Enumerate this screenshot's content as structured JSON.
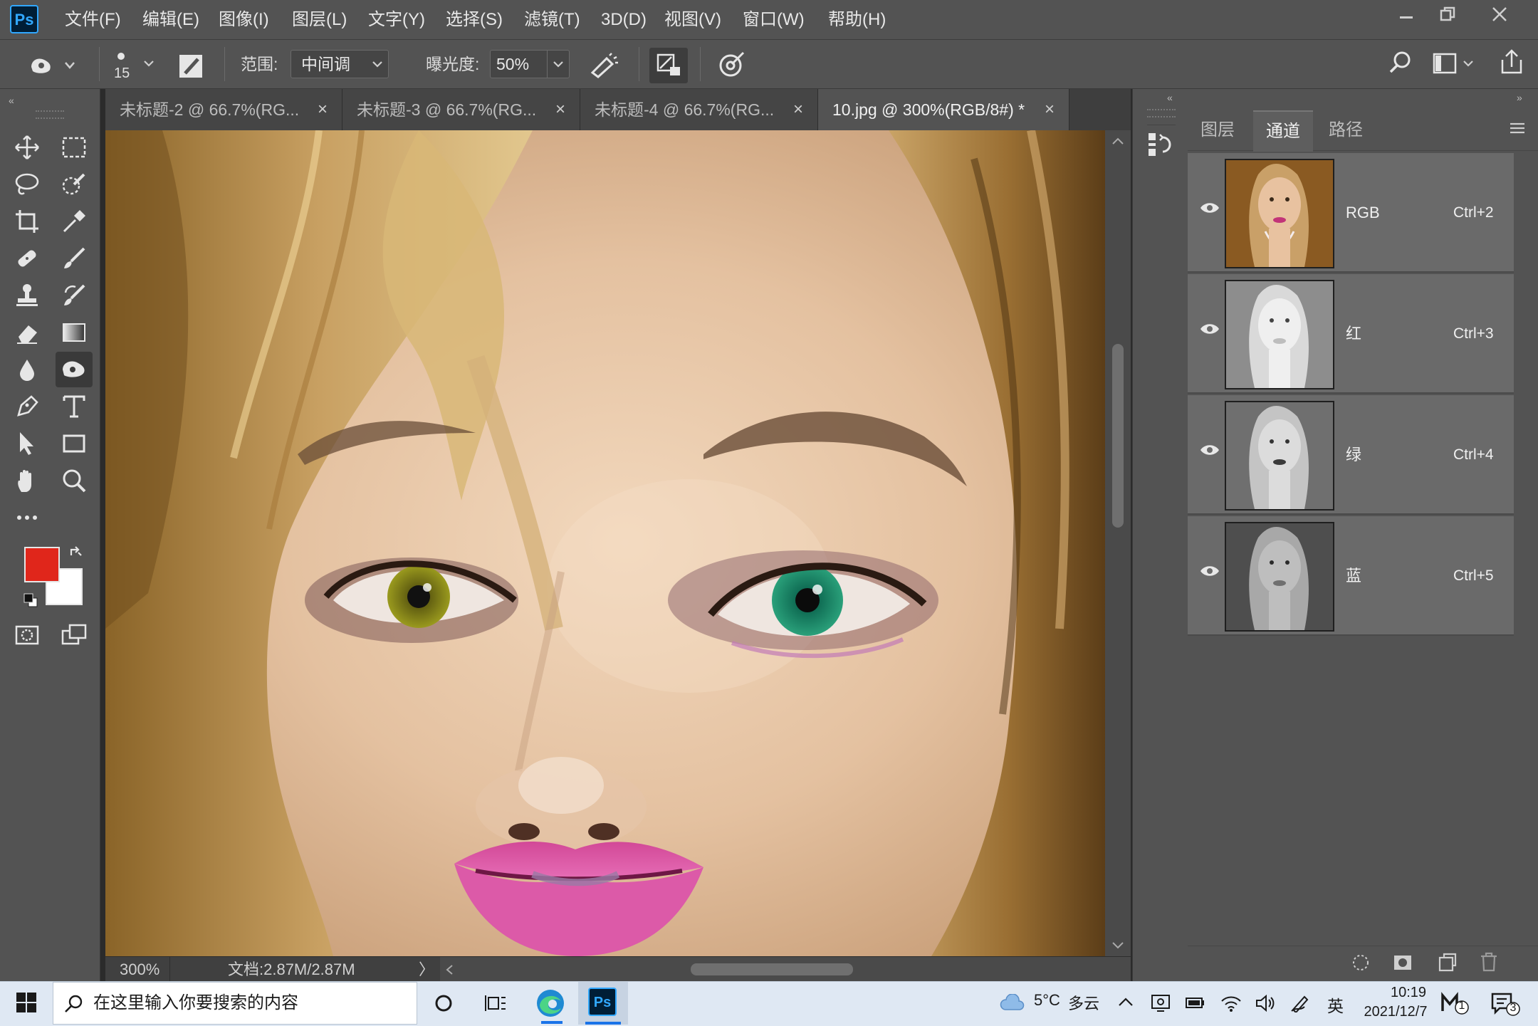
{
  "app": {
    "logo": "Ps"
  },
  "menu": [
    "文件(F)",
    "编辑(E)",
    "图像(I)",
    "图层(L)",
    "文字(Y)",
    "选择(S)",
    "滤镜(T)",
    "3D(D)",
    "视图(V)",
    "窗口(W)",
    "帮助(H)"
  ],
  "options": {
    "brush_size": "15",
    "range_label": "范围:",
    "range_value": "中间调",
    "exposure_label": "曝光度:",
    "exposure_value": "50%"
  },
  "tabs": [
    {
      "label": "未标题-2 @ 66.7%(RG...",
      "active": false
    },
    {
      "label": "未标题-3 @ 66.7%(RG...",
      "active": false
    },
    {
      "label": "未标题-4 @ 66.7%(RG...",
      "active": false
    },
    {
      "label": "10.jpg @ 300%(RGB/8#) *",
      "active": true
    }
  ],
  "tab_close_glyph": "×",
  "status": {
    "zoom": "300%",
    "doc_info": "文档:2.87M/2.87M",
    "more": "〉"
  },
  "colors": {
    "foreground": "#e0261b",
    "background": "#ffffff",
    "accent": "#31a8ff"
  },
  "panel": {
    "tabs": [
      "图层",
      "通道",
      "路径"
    ],
    "active_tab": "通道",
    "channels": [
      {
        "name": "RGB",
        "shortcut": "Ctrl+2",
        "kind": "color"
      },
      {
        "name": "红",
        "shortcut": "Ctrl+3",
        "kind": "gray-light"
      },
      {
        "name": "绿",
        "shortcut": "Ctrl+4",
        "kind": "gray-mid"
      },
      {
        "name": "蓝",
        "shortcut": "Ctrl+5",
        "kind": "gray-dark"
      }
    ]
  },
  "taskbar": {
    "search_placeholder": "在这里输入你要搜索的内容",
    "weather_temp": "5°C",
    "weather_desc": "多云",
    "ime": "英",
    "time": "10:19",
    "date": "2021/12/7",
    "notification_count": "3",
    "app_badge": "1"
  }
}
